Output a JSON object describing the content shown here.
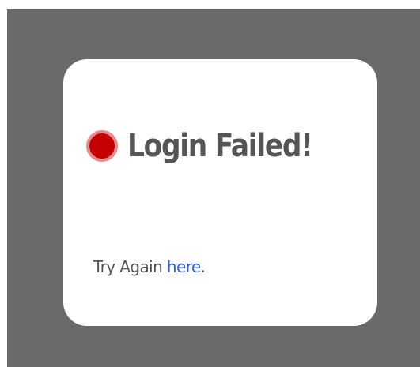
{
  "dialog": {
    "title": "Login Failed!",
    "status_color": "#c40000",
    "message_prefix": "Try Again ",
    "link_label": "here",
    "message_suffix": "."
  }
}
